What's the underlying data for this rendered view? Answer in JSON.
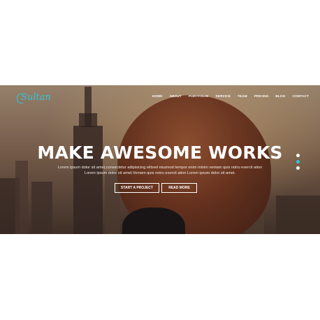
{
  "brand": {
    "logo_text": "Sultan",
    "accent": "#32c4d4"
  },
  "nav": {
    "items": [
      {
        "label": "HOME"
      },
      {
        "label": "ABOUT"
      },
      {
        "label": "PORTFOLIO"
      },
      {
        "label": "SERVICE"
      },
      {
        "label": "TEAM"
      },
      {
        "label": "PRICING"
      },
      {
        "label": "BLOG"
      },
      {
        "label": "CONTACT"
      }
    ]
  },
  "hero": {
    "title": "MAKE AWESOME WORKS",
    "subtitle_line1": "Lorem ipsum dolor sit amet,consectetur adipisicing elitsed eiusmod tempor enim minim veniam quis notru exercit ation",
    "subtitle_line2": "Lorem ipsum dolor sit amet.Veniam quis notru exercit ation Lorem ipsum dolor sit amet.",
    "buttons": {
      "start_label": "START A PROJECT",
      "read_label": "READ MORE"
    },
    "slider": {
      "slide_count": 3,
      "active_slide": 2
    }
  }
}
